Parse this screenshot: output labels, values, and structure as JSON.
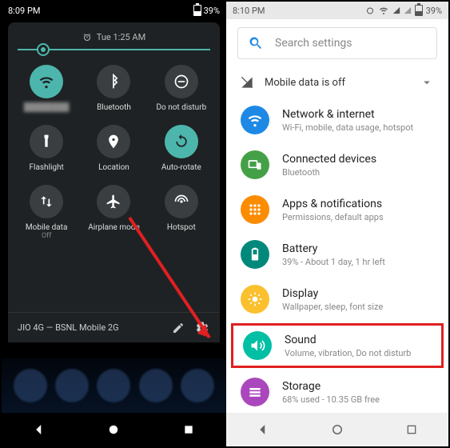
{
  "left": {
    "status": {
      "time": "8:09 PM",
      "battery": "39%"
    },
    "panel_time": "Tue 1:25 AM",
    "tiles": [
      {
        "label": "",
        "sub": "",
        "icon": "wifi",
        "active": true
      },
      {
        "label": "Bluetooth",
        "icon": "bluetooth"
      },
      {
        "label": "Do not disturb",
        "icon": "dnd"
      },
      {
        "label": "Flashlight",
        "icon": "flashlight"
      },
      {
        "label": "Location",
        "icon": "location"
      },
      {
        "label": "Auto-rotate",
        "icon": "rotate",
        "active": true
      },
      {
        "label": "Mobile data",
        "sub": "Off",
        "icon": "data"
      },
      {
        "label": "Airplane mode",
        "icon": "airplane"
      },
      {
        "label": "Hotspot",
        "icon": "hotspot"
      }
    ],
    "footer": "JIO 4G — BSNL Mobile 2G"
  },
  "right": {
    "status": {
      "time": "8:10 PM",
      "battery": "39%"
    },
    "search_placeholder": "Search settings",
    "mobile_data": "Mobile data is off",
    "items": [
      {
        "title": "Network & internet",
        "sub": "Wi-Fi, mobile, data usage, hotspot",
        "color": "#1e88e5",
        "icon": "wifi"
      },
      {
        "title": "Connected devices",
        "sub": "Bluetooth",
        "color": "#43a047",
        "icon": "devices"
      },
      {
        "title": "Apps & notifications",
        "sub": "Permissions, default apps",
        "color": "#fb8c00",
        "icon": "apps"
      },
      {
        "title": "Battery",
        "sub": "39% - About 1 day, 1 hr left",
        "color": "#00897b",
        "icon": "battery"
      },
      {
        "title": "Display",
        "sub": "Wallpaper, sleep, font size",
        "color": "#fbc02d",
        "icon": "display"
      },
      {
        "title": "Sound",
        "sub": "Volume, vibration, Do not disturb",
        "color": "#00bfa5",
        "icon": "sound",
        "highlight": true
      },
      {
        "title": "Storage",
        "sub": "68% used - 10.35 GB free",
        "color": "#ab47bc",
        "icon": "storage"
      }
    ]
  }
}
